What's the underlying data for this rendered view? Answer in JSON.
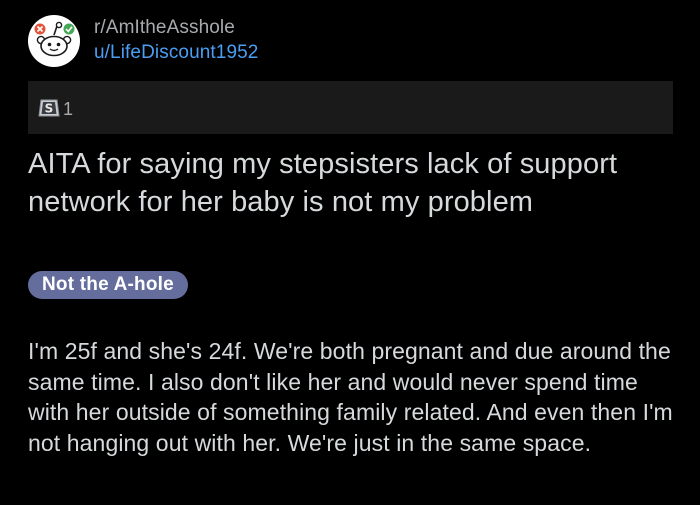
{
  "post": {
    "subreddit": "r/AmItheAsshole",
    "username": "u/LifeDiscount1952",
    "award_icon": "silver-award-icon",
    "award_count": "1",
    "title": "AITA for saying my stepsisters lack of support network for her baby is not my problem",
    "flair": "Not the A-hole",
    "body": "I'm 25f and she's 24f. We're both pregnant and due around the same time. I also don't like her and would never spend time with her outside of something family related. And even then I'm not hanging out with her. We're just in the same space."
  },
  "colors": {
    "background": "#000000",
    "award_bar": "#1a1a1b",
    "username": "#4a9ff5",
    "flair_bg": "#646d9c",
    "text": "#d7dadc",
    "muted": "#a8abad"
  }
}
